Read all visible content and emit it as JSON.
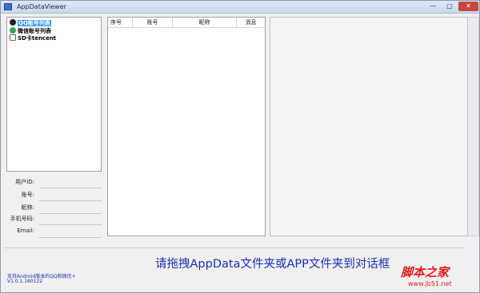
{
  "window": {
    "title": "AppDataViewer",
    "minimize_glyph": "—",
    "maximize_glyph": "□",
    "close_glyph": "✕"
  },
  "tree": {
    "items": [
      {
        "label": "QQ账号列表",
        "icon": "qq-icon"
      },
      {
        "label": "微信账号列表",
        "icon": "wechat-icon"
      },
      {
        "label": "SD卡tencent",
        "icon": "sdcard-icon"
      }
    ]
  },
  "account_fields": {
    "user_id_label": "用户ID:",
    "account_label": "账号:",
    "nickname_label": "昵称:",
    "phone_label": "手机号码:",
    "email_label": "Email:"
  },
  "table": {
    "columns": [
      "序号",
      "账号",
      "昵称",
      "消息"
    ]
  },
  "footer": {
    "support_text": "支持Android版本的QQ和微信+",
    "version": "V1.0.1.160122",
    "drop_hint": "请拖拽AppData文件夹或APP文件夹到对话框"
  },
  "watermark": {
    "brand": "脚本之家",
    "url": "www.jb51.net"
  },
  "colors": {
    "accent_blue": "#1a2fb5",
    "selection": "#3399ff",
    "watermark_red": "#e31b1b"
  }
}
